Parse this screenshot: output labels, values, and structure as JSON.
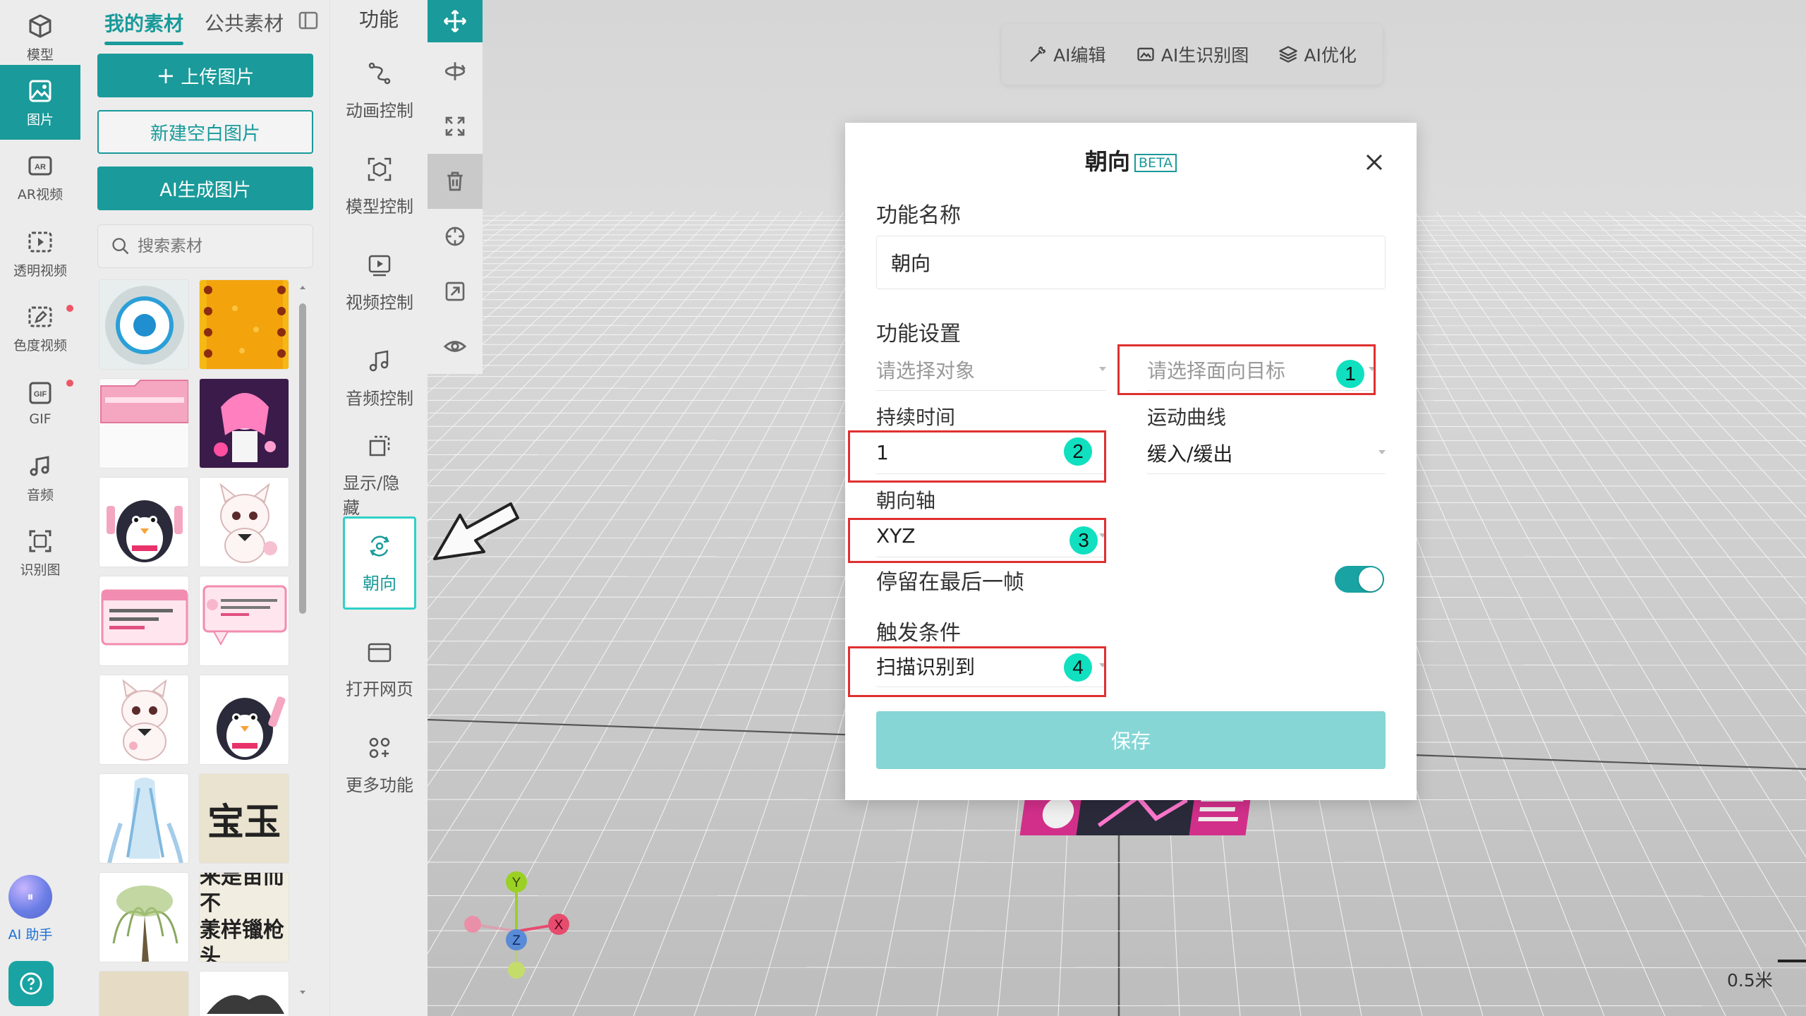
{
  "left_rail": {
    "items": [
      {
        "label": "模型",
        "icon": "cube-icon"
      },
      {
        "label": "图片",
        "icon": "image-icon"
      },
      {
        "label": "AR视频",
        "icon": "ar-icon"
      },
      {
        "label": "透明视频",
        "icon": "play-frame-icon"
      },
      {
        "label": "色度视频",
        "icon": "edit-frame-icon"
      },
      {
        "label": "GIF",
        "icon": "gif-icon"
      },
      {
        "label": "音频",
        "icon": "music-icon"
      },
      {
        "label": "识别图",
        "icon": "scan-image-icon"
      }
    ],
    "ai_helper": "AI 助手",
    "ai_orb_glyph": "⏸"
  },
  "asset_panel": {
    "tabs": [
      "我的素材",
      "公共素材"
    ],
    "upload_label": "上传图片",
    "new_blank_label": "新建空白图片",
    "ai_generate_label": "AI生成图片",
    "search_placeholder": "搜索素材",
    "thumb_text": [
      "宝玉",
      "来是苗而不\n羕样镴枪头"
    ]
  },
  "func_panel": {
    "title": "功能",
    "items": [
      {
        "label": "动画控制",
        "icon": "animation-icon"
      },
      {
        "label": "模型控制",
        "icon": "model-control-icon"
      },
      {
        "label": "视频控制",
        "icon": "video-control-icon"
      },
      {
        "label": "音频控制",
        "icon": "audio-control-icon"
      },
      {
        "label": "显示/隐藏",
        "icon": "show-hide-icon"
      },
      {
        "label": "朝向",
        "icon": "orientation-icon"
      },
      {
        "label": "打开网页",
        "icon": "webpage-icon"
      },
      {
        "label": "更多功能",
        "icon": "more-functions-icon"
      }
    ]
  },
  "ai_toolbar": {
    "edit": "AI编辑",
    "gen_marker": "AI生识别图",
    "optimize": "AI优化"
  },
  "dialog": {
    "title": "朝向",
    "badge": "BETA",
    "name_label": "功能名称",
    "name_value": "朝向",
    "settings_label": "功能设置",
    "object_placeholder": "请选择对象",
    "target_placeholder": "请选择面向目标",
    "duration_label": "持续时间",
    "duration_value": "1",
    "curve_label": "运动曲线",
    "curve_value": "缓入/缓出",
    "axis_label": "朝向轴",
    "axis_value": "XYZ",
    "stay_last_label": "停留在最后一帧",
    "stay_last_on": true,
    "trigger_label": "触发条件",
    "trigger_value": "扫描识别到",
    "save_label": "保存",
    "badges": [
      "1",
      "2",
      "3",
      "4"
    ]
  },
  "gizmo": {
    "x": "X",
    "y": "Y",
    "z": "Z"
  },
  "scale_label": "0.5米",
  "colors": {
    "accent": "#1a9a9a",
    "save_disabled": "#86d6d6",
    "highlight_border": "#e03030",
    "badge": "#10e0c0"
  }
}
